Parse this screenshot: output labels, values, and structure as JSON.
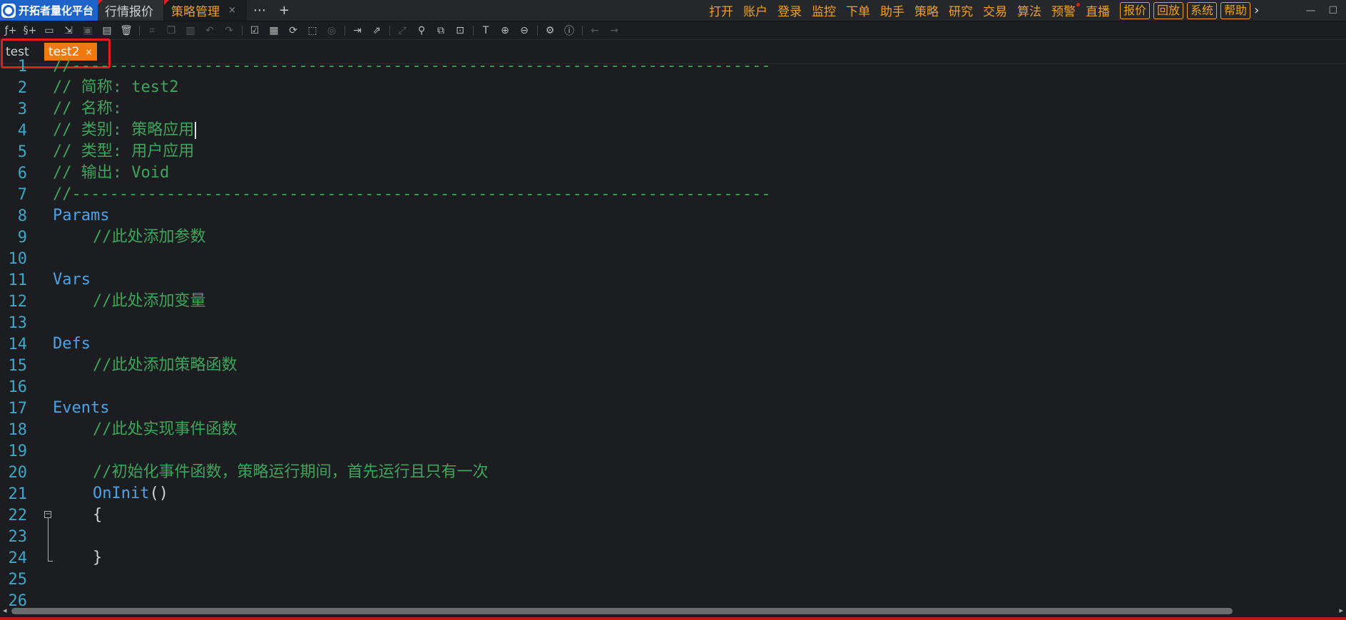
{
  "app": {
    "title": "开拓者量化平台"
  },
  "top_tabs": [
    {
      "label": "行情报价",
      "active": false
    },
    {
      "label": "策略管理",
      "active": true,
      "close": "×"
    }
  ],
  "top_more": "⋯",
  "top_add": "+",
  "menu": [
    "打开",
    "账户",
    "登录",
    "监控",
    "下单",
    "助手",
    "策略",
    "研究",
    "交易",
    "算法",
    "预警",
    "直播"
  ],
  "menu_buttons": [
    "报价",
    "回放",
    "系统",
    "帮助"
  ],
  "menu_arrow": "›",
  "window_controls": [
    "—",
    "☐"
  ],
  "toolbar_icons": [
    "new-function-icon",
    "new-strategy-icon",
    "open-folder-icon",
    "import-icon",
    "save-icon",
    "save-all-icon",
    "delete-icon",
    "crop-icon",
    "copy-icon",
    "paste-icon",
    "undo-icon",
    "redo-icon",
    "compile-icon",
    "compile-all-icon",
    "check-icon",
    "select-icon",
    "record-icon",
    "insert-icon",
    "export-icon",
    "expand-icon",
    "search-icon",
    "find-replace-icon",
    "find-next-icon",
    "font-icon",
    "zoom-in-icon",
    "zoom-out-icon",
    "settings-icon",
    "info-icon",
    "back-icon",
    "forward-icon"
  ],
  "doc_tabs": [
    {
      "label": "test",
      "active": false
    },
    {
      "label": "test2",
      "active": true,
      "close": "×"
    }
  ],
  "editor": {
    "lines": [
      {
        "n": "1",
        "text": "//--------------------------------------------------------------------------",
        "type": "comment"
      },
      {
        "n": "2",
        "text": "// 简称: test2",
        "type": "comment"
      },
      {
        "n": "3",
        "text": "// 名称:",
        "type": "comment"
      },
      {
        "n": "4",
        "text": "// 类别: 策略应用",
        "type": "comment"
      },
      {
        "n": "5",
        "text": "// 类型: 用户应用",
        "type": "comment"
      },
      {
        "n": "6",
        "text": "// 输出: Void",
        "type": "comment"
      },
      {
        "n": "7",
        "text": "//--------------------------------------------------------------------------",
        "type": "comment"
      },
      {
        "n": "8",
        "text": "Params",
        "type": "keyword"
      },
      {
        "n": "9",
        "text": "//此处添加参数",
        "type": "comment-indent"
      },
      {
        "n": "10",
        "text": "",
        "type": "blank"
      },
      {
        "n": "11",
        "text": "Vars",
        "type": "keyword"
      },
      {
        "n": "12",
        "text": "//此处添加变量",
        "type": "comment-indent"
      },
      {
        "n": "13",
        "text": "",
        "type": "blank"
      },
      {
        "n": "14",
        "text": "Defs",
        "type": "keyword"
      },
      {
        "n": "15",
        "text": "//此处添加策略函数",
        "type": "comment-indent"
      },
      {
        "n": "16",
        "text": "",
        "type": "blank"
      },
      {
        "n": "17",
        "text": "Events",
        "type": "keyword"
      },
      {
        "n": "18",
        "text": "//此处实现事件函数",
        "type": "comment-indent"
      },
      {
        "n": "19",
        "text": "",
        "type": "blank"
      },
      {
        "n": "20",
        "text": "//初始化事件函数，策略运行期间，首先运行且只有一次",
        "type": "comment-indent"
      },
      {
        "n": "21",
        "text": "OnInit",
        "type": "function"
      },
      {
        "n": "22",
        "text": "{",
        "type": "plain-indent"
      },
      {
        "n": "23",
        "text": "",
        "type": "blank"
      },
      {
        "n": "24",
        "text": "}",
        "type": "plain-indent"
      },
      {
        "n": "25",
        "text": "",
        "type": "blank"
      },
      {
        "n": "26",
        "text": "",
        "type": "blank"
      }
    ],
    "function_parens": "()",
    "fold_marker": "−"
  },
  "scroll": {
    "left_arrow": "◂",
    "right_arrow": "▸"
  }
}
